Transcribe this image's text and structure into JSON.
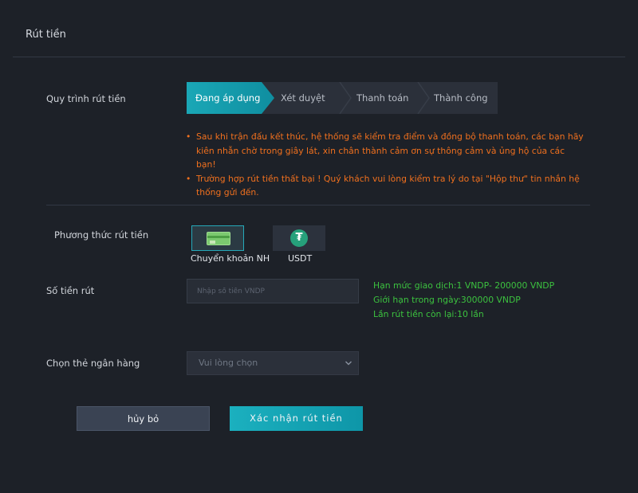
{
  "panel": {
    "title": "Rút tiền"
  },
  "process": {
    "label": "Quy trình rút tiền",
    "steps": [
      "Đang áp dụng",
      "Xét duyệt",
      "Thanh toán",
      "Thành công"
    ],
    "active_index": 0,
    "accent_color": "#1aa7b6"
  },
  "notes": {
    "color": "#f0701e",
    "items": [
      {
        "bullet": "•",
        "line1": "Sau khi trận đấu kết thúc, hệ thống sẽ kiểm tra điểm và đồng bộ thanh toán, các bạn hãy",
        "line2": "kiên nhẫn chờ trong giây lát, xin chân thành cảm ơn sự thông cảm và ủng hộ của các bạn!"
      },
      {
        "bullet": "•",
        "line1": "Trường hợp rút tiền thất bại ! Quý khách vui lòng kiểm tra lý do tại \"Hộp thư\" tin nhắn hệ",
        "line2": "thống gửi đến."
      }
    ]
  },
  "method": {
    "label": "Phương thức rút tiền",
    "options": [
      {
        "label": "Chuyển khoản NH",
        "icon": "bank-card-icon",
        "selected": true
      },
      {
        "label": "USDT",
        "icon": "tether-icon",
        "symbol": "₮",
        "selected": false
      }
    ]
  },
  "amount": {
    "label": "Số tiền rút",
    "placeholder": "Nhập số tiền VNDP",
    "value": "",
    "limits": [
      "Hạn mức giao dịch:1 VNDP- 200000 VNDP",
      "Giới hạn trong ngày:300000 VNDP",
      "Lần rút tiền còn lại:10 lần"
    ],
    "limits_color": "#3cc23f"
  },
  "bank": {
    "label": "Chọn thẻ ngân hàng",
    "selected": "Vui lòng chọn",
    "icon": "chevron-down-icon"
  },
  "actions": {
    "cancel_label": "hủy bỏ",
    "confirm_label": "Xác nhận rút tiền"
  }
}
